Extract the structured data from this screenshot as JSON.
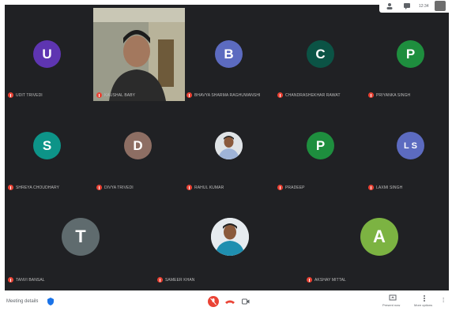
{
  "top_bar": {
    "time": "12:34"
  },
  "participants": [
    {
      "key": "u",
      "initial": "U",
      "color": "#5e35b1",
      "name": "UDIT TRIVEDI"
    },
    {
      "key": "self",
      "initial": "",
      "color": "",
      "name": "KAUSHAL BABY"
    },
    {
      "key": "b",
      "initial": "B",
      "color": "#5c6bc0",
      "name": "BHAVYA SHARMA RAGHUWANSHI"
    },
    {
      "key": "c",
      "initial": "C",
      "color": "#0b5345",
      "name": "CHANDRASHEKHAR RAWAT"
    },
    {
      "key": "p1",
      "initial": "P",
      "color": "#1e8e3e",
      "name": "PRIYANKA SINGH"
    },
    {
      "key": "s",
      "initial": "S",
      "color": "#0d9488",
      "name": "SHREYA CHOUDHARY"
    },
    {
      "key": "d",
      "initial": "D",
      "color": "#8d6e63",
      "name": "DIVYA TRIVEDI"
    },
    {
      "key": "photo1",
      "initial": "",
      "color": "",
      "name": "RAHUL KUMAR"
    },
    {
      "key": "p2",
      "initial": "P",
      "color": "#1e8e3e",
      "name": "PRADEEP"
    },
    {
      "key": "ls",
      "initial": "L S",
      "color": "#5c6bc0",
      "name": "LAXMI SINGH"
    },
    {
      "key": "t",
      "initial": "T",
      "color": "#5f6b6e",
      "name": "TANVI BANSAL"
    },
    {
      "key": "photo2",
      "initial": "",
      "color": "",
      "name": "SAMEER KHAN"
    },
    {
      "key": "a",
      "initial": "A",
      "color": "#7cb342",
      "name": "AKSHAY MITTAL"
    }
  ],
  "bottom_bar": {
    "meeting_details": "Meeting details",
    "present_label": "Present now",
    "more_label": "More options"
  }
}
